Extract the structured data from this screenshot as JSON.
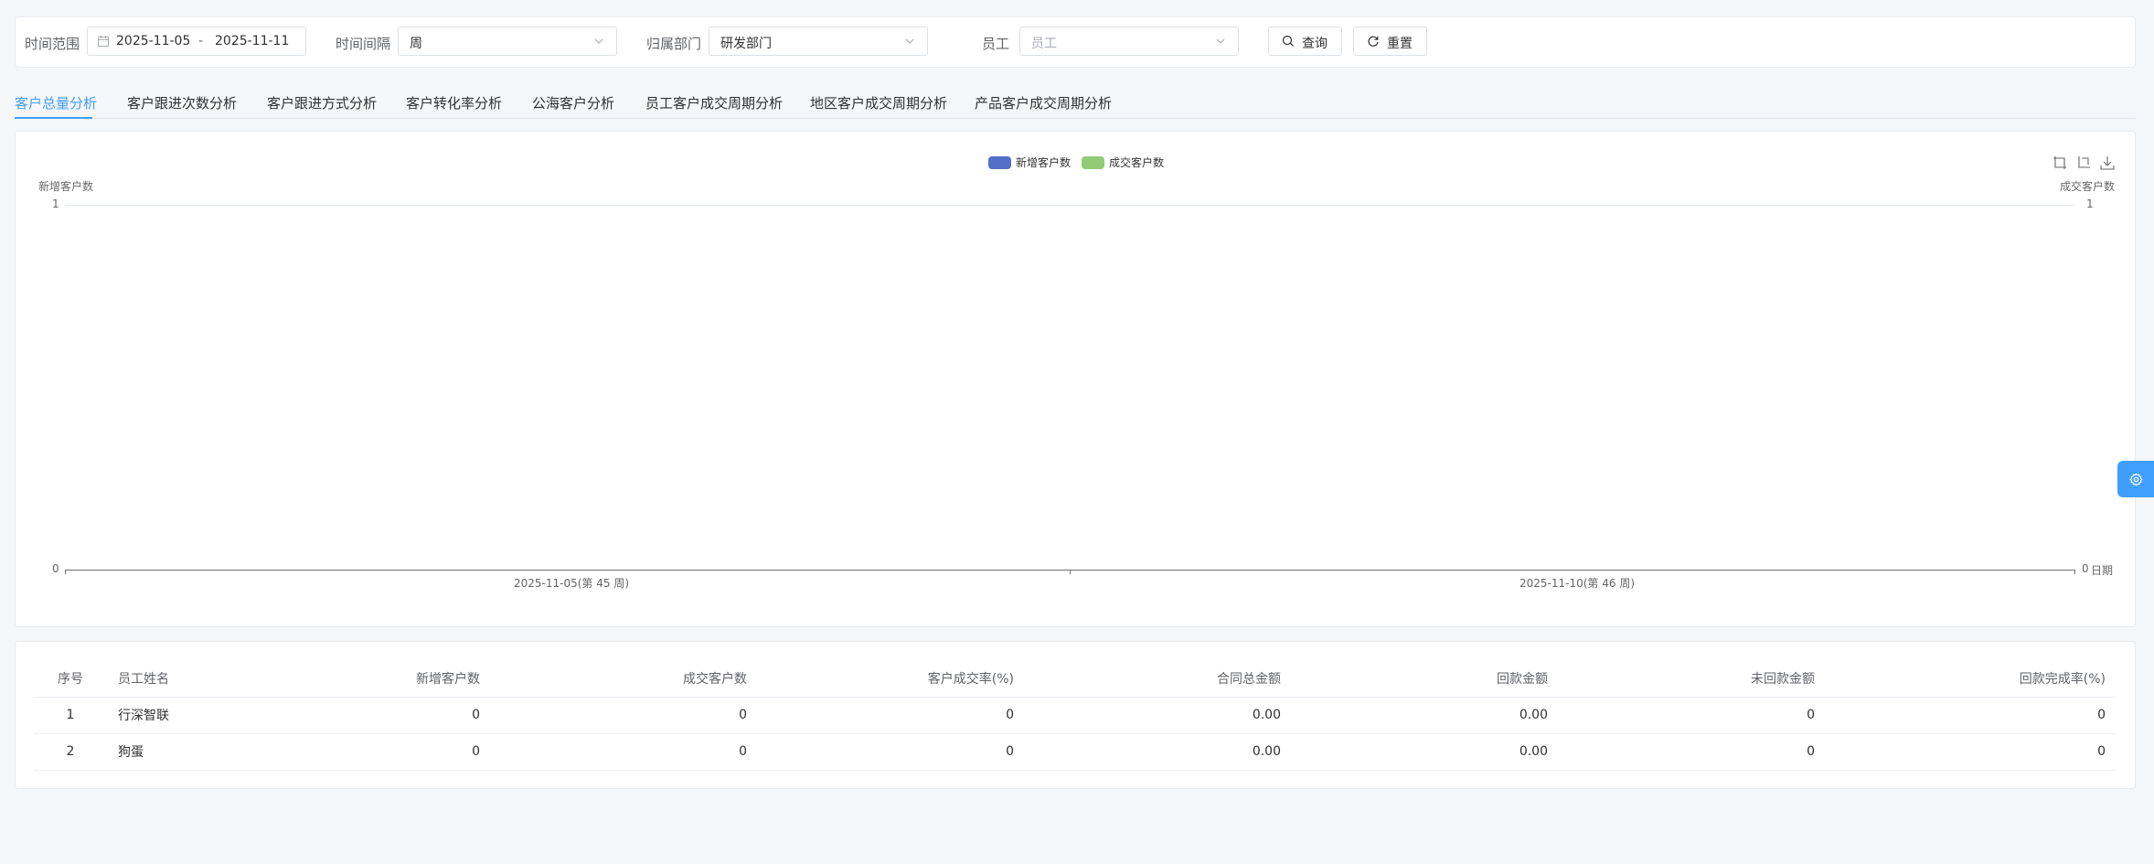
{
  "filters": {
    "time_range_label": "时间范围",
    "start_date": "2025-11-05",
    "date_separator": "-",
    "end_date": "2025-11-11",
    "interval_label": "时间间隔",
    "interval_value": "周",
    "department_label": "归属部门",
    "department_value": "研发部门",
    "employee_label": "员工",
    "employee_placeholder": "员工",
    "query_label": "查询",
    "reset_label": "重置"
  },
  "tabs": [
    {
      "label": "客户总量分析"
    },
    {
      "label": "客户跟进次数分析"
    },
    {
      "label": "客户跟进方式分析"
    },
    {
      "label": "客户转化率分析"
    },
    {
      "label": "公海客户分析"
    },
    {
      "label": "员工客户成交周期分析"
    },
    {
      "label": "地区客户成交周期分析"
    },
    {
      "label": "产品客户成交周期分析"
    }
  ],
  "active_tab": 0,
  "chart_data": {
    "type": "line",
    "categories": [
      "2025-11-05(第 45 周)",
      "2025-11-10(第 46 周)"
    ],
    "series": [
      {
        "name": "新增客户数",
        "values": [
          0,
          0
        ],
        "color": "#5470c6"
      },
      {
        "name": "成交客户数",
        "values": [
          0,
          0
        ],
        "color": "#91cc75"
      }
    ],
    "ylabel_left": "新增客户数",
    "ylabel_right": "成交客户数",
    "xlabel": "日期",
    "y_ticks_left": [
      "1",
      "0"
    ],
    "y_ticks_right": [
      "1",
      "0"
    ],
    "ylim": [
      0,
      1
    ],
    "legend_position": "top-center",
    "toolbox": [
      "zoom-icon",
      "zoom-reset-icon",
      "download-icon"
    ]
  },
  "table": {
    "headers": [
      "序号",
      "员工姓名",
      "新增客户数",
      "成交客户数",
      "客户成交率(%)",
      "合同总金额",
      "回款金额",
      "未回款金额",
      "回款完成率(%)"
    ],
    "rows": [
      [
        "1",
        "行深智联",
        "0",
        "0",
        "0",
        "0.00",
        "0.00",
        "0",
        "0"
      ],
      [
        "2",
        "狗蛋",
        "0",
        "0",
        "0",
        "0.00",
        "0.00",
        "0",
        "0"
      ]
    ]
  },
  "colors": {
    "accent": "#409eff",
    "series_new": "#5470c6",
    "series_deal": "#91cc75"
  }
}
